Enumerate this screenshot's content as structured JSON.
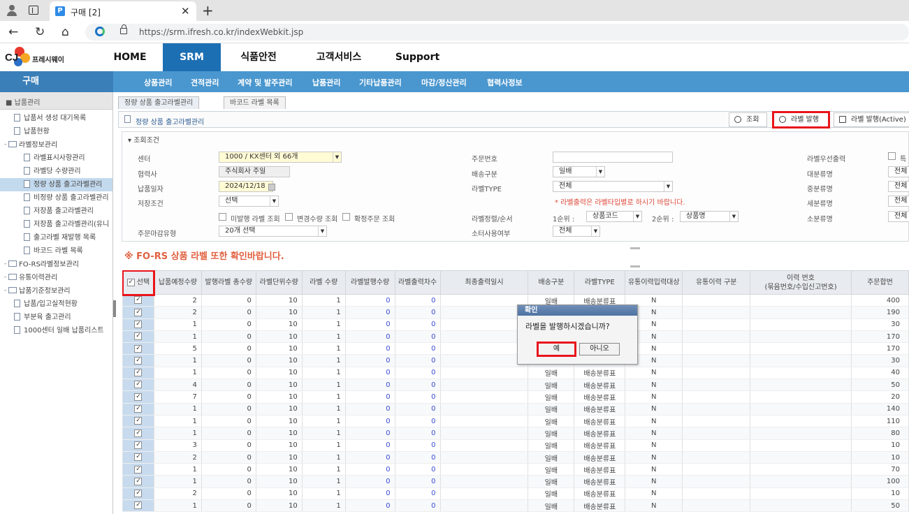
{
  "browser": {
    "tab_title": "구매 [2]",
    "tab_favicon": "P",
    "url": "https://srm.ifresh.co.kr/indexWebkit.jsp"
  },
  "header": {
    "logo_text": "CJ",
    "logo_name": "프레시웨이",
    "nav": [
      "HOME",
      "SRM",
      "식품안전",
      "고객서비스",
      "Support"
    ],
    "active_nav": "SRM"
  },
  "subnav": {
    "section": "구매",
    "items": [
      "상품관리",
      "견적관리",
      "계약 및 발주관리",
      "납품관리",
      "기타납품관리",
      "마감/정산관리",
      "협력사정보"
    ]
  },
  "sidebar": {
    "header": "■ 납품관리",
    "items": [
      {
        "label": "납품서 생성 대기목록",
        "type": "doc",
        "level": 1
      },
      {
        "label": "납품현황",
        "type": "doc",
        "level": 1
      },
      {
        "label": "라벨정보관리",
        "type": "folder",
        "level": 0
      },
      {
        "label": "라벨표시사항관리",
        "type": "doc",
        "level": 2
      },
      {
        "label": "라벨당 수량관리",
        "type": "doc",
        "level": 2
      },
      {
        "label": "정량 상품 출고라벨관리",
        "type": "doc",
        "level": 2,
        "selected": true
      },
      {
        "label": "비정량 상품 출고라벨관리",
        "type": "doc",
        "level": 2
      },
      {
        "label": "저장품 출고라벨관리",
        "type": "doc",
        "level": 2
      },
      {
        "label": "저장품 출고라벨관리(유니",
        "type": "doc",
        "level": 2
      },
      {
        "label": "출고라벨 재발행 목록",
        "type": "doc",
        "level": 2
      },
      {
        "label": "바코드 라벨 목록",
        "type": "doc",
        "level": 2
      },
      {
        "label": "FO-RS라벨정보관리",
        "type": "folder",
        "level": 0
      },
      {
        "label": "유통이력관리",
        "type": "folder",
        "level": 0
      },
      {
        "label": "납품기준정보관리",
        "type": "folder",
        "level": 0
      },
      {
        "label": "납품/입고실적현황",
        "type": "doc",
        "level": 1
      },
      {
        "label": "부분육 출고관리",
        "type": "doc",
        "level": 1
      },
      {
        "label": "1000센터 일배 납품리스트",
        "type": "doc",
        "level": 1
      }
    ]
  },
  "content": {
    "tabs": [
      "정량 상품 출고라벨관리",
      "바코드 라벨 목록"
    ],
    "title": "정량 상품 출고라벨관리",
    "buttons": {
      "search": "조회",
      "issue": "라벨 발행",
      "issue_active": "라벨 발행(Active)"
    },
    "cond_header": "조회조건",
    "fields": {
      "center_label": "센터",
      "center_value": "1000 / KX센터 외 66개",
      "partner_label": "협력사",
      "partner_value": "주식회사 주일",
      "date_label": "납품일자",
      "date_value": "2024/12/18",
      "store_label": "저장조건",
      "store_value": "선택",
      "chk1": "미발행 라벨 조회",
      "chk2": "변경수량 조회",
      "chk3": "확정주문 조회",
      "deadline_label": "주문마감유형",
      "deadline_value": "20개 선택",
      "order_no_label": "주문번호",
      "order_no_value": "",
      "delivery_label": "배송구분",
      "delivery_value": "일배",
      "labeltype_label": "라벨TYPE",
      "labeltype_value": "전체",
      "labeltype_note": "* 라벨출력은 라벨타입별로 하시기 바랍니다.",
      "sort_label": "라벨정렬/순서",
      "sort1_label": "1순위 :",
      "sort1_value": "상품코드",
      "sort2_label": "2순위 :",
      "sort2_value": "상품명",
      "subdiv_label": "소터사용여부",
      "subdiv_value": "전체",
      "prio_label": "라벨우선출력",
      "prio_check": "특",
      "cat_large_label": "대분류명",
      "cat_large_value": "전체",
      "cat_mid_label": "중분류명",
      "cat_mid_value": "전체",
      "cat_small_label": "세분류명",
      "cat_small_value": "전체",
      "cat_sub_label": "소분류명",
      "cat_sub_value": "전체"
    },
    "warning": "※ FO-RS 상품 라벨 또한 확인바랍니다."
  },
  "grid": {
    "headers": [
      "선택",
      "납품예정수량",
      "발행라벨 총수량",
      "라벨단위수량",
      "라벨 수량",
      "라벨발행수량",
      "라벨출력차수",
      "최종출력일시",
      "배송구분",
      "라벨TYPE",
      "유통이력입력대상",
      "유통이력 구분",
      "이력 번호\n(묶음번호/수입신고번호)",
      "주문합번"
    ],
    "rows": [
      [
        "2",
        "0",
        "10",
        "1",
        "0",
        "0",
        "",
        "일배",
        "배송분류표",
        "N",
        "",
        "",
        "400"
      ],
      [
        "2",
        "0",
        "10",
        "1",
        "0",
        "0",
        "",
        "일배",
        "배송분류표",
        "N",
        "",
        "",
        "190"
      ],
      [
        "1",
        "0",
        "10",
        "1",
        "0",
        "0",
        "",
        "일배",
        "배송분류표",
        "N",
        "",
        "",
        "30"
      ],
      [
        "1",
        "0",
        "10",
        "1",
        "0",
        "0",
        "",
        "일배",
        "배송분류표",
        "N",
        "",
        "",
        "170"
      ],
      [
        "5",
        "0",
        "10",
        "1",
        "0",
        "0",
        "",
        "일배",
        "배송분류표",
        "N",
        "",
        "",
        "170"
      ],
      [
        "1",
        "0",
        "10",
        "1",
        "0",
        "0",
        "",
        "일배",
        "배송분류표",
        "N",
        "",
        "",
        "30"
      ],
      [
        "1",
        "0",
        "10",
        "1",
        "0",
        "0",
        "",
        "일배",
        "배송분류표",
        "N",
        "",
        "",
        "40"
      ],
      [
        "4",
        "0",
        "10",
        "1",
        "0",
        "0",
        "",
        "일배",
        "배송분류표",
        "N",
        "",
        "",
        "50"
      ],
      [
        "7",
        "0",
        "10",
        "1",
        "0",
        "0",
        "",
        "일배",
        "배송분류표",
        "N",
        "",
        "",
        "20"
      ],
      [
        "1",
        "0",
        "10",
        "1",
        "0",
        "0",
        "",
        "일배",
        "배송분류표",
        "N",
        "",
        "",
        "140"
      ],
      [
        "1",
        "0",
        "10",
        "1",
        "0",
        "0",
        "",
        "일배",
        "배송분류표",
        "N",
        "",
        "",
        "110"
      ],
      [
        "1",
        "0",
        "10",
        "1",
        "0",
        "0",
        "",
        "일배",
        "배송분류표",
        "N",
        "",
        "",
        "80"
      ],
      [
        "3",
        "0",
        "10",
        "1",
        "0",
        "0",
        "",
        "일배",
        "배송분류표",
        "N",
        "",
        "",
        "10"
      ],
      [
        "2",
        "0",
        "10",
        "1",
        "0",
        "0",
        "",
        "일배",
        "배송분류표",
        "N",
        "",
        "",
        "10"
      ],
      [
        "1",
        "0",
        "10",
        "1",
        "0",
        "0",
        "",
        "일배",
        "배송분류표",
        "N",
        "",
        "",
        "70"
      ],
      [
        "1",
        "0",
        "10",
        "1",
        "0",
        "0",
        "",
        "일배",
        "배송분류표",
        "N",
        "",
        "",
        "100"
      ],
      [
        "2",
        "0",
        "10",
        "1",
        "0",
        "0",
        "",
        "일배",
        "배송분류표",
        "N",
        "",
        "",
        "10"
      ],
      [
        "1",
        "0",
        "10",
        "1",
        "0",
        "0",
        "",
        "일배",
        "배송분류표",
        "N",
        "",
        "",
        "50"
      ]
    ]
  },
  "dialog": {
    "title": "확인",
    "message": "라벨을 발행하시겠습니까?",
    "yes": "예",
    "no": "아니오"
  },
  "colors": {
    "accent": "#1d6fb3",
    "subnav": "#4a97cf",
    "highlight": "#e8151b",
    "warning": "#e06040"
  }
}
